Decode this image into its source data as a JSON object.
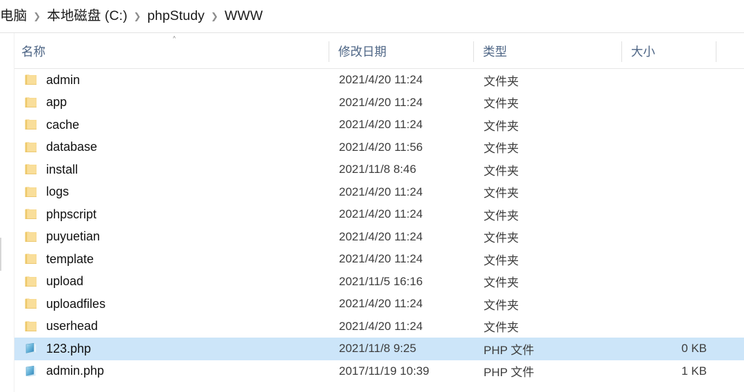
{
  "window": {
    "title": "WWW"
  },
  "breadcrumb": {
    "separator": "❯",
    "items": [
      {
        "label": "电脑"
      },
      {
        "label": "本地磁盘 (C:)"
      },
      {
        "label": "phpStudy"
      },
      {
        "label": "WWW"
      }
    ]
  },
  "columns": {
    "sort_indicator": "˄",
    "sorted_by": "name",
    "sort_direction": "ascending",
    "headers": [
      {
        "key": "name",
        "label": "名称"
      },
      {
        "key": "date",
        "label": "修改日期"
      },
      {
        "key": "type",
        "label": "类型"
      },
      {
        "key": "size",
        "label": "大小"
      }
    ]
  },
  "colors": {
    "selection": "#cce5f9",
    "folder_icon": "#f5d municipal",
    "header_text": "#4d6585"
  },
  "files": [
    {
      "name": "admin",
      "date": "2021/4/20 11:24",
      "type": "文件夹",
      "size": "",
      "icon": "folder-icon",
      "selected": false
    },
    {
      "name": "app",
      "date": "2021/4/20 11:24",
      "type": "文件夹",
      "size": "",
      "icon": "folder-icon",
      "selected": false
    },
    {
      "name": "cache",
      "date": "2021/4/20 11:24",
      "type": "文件夹",
      "size": "",
      "icon": "folder-icon",
      "selected": false
    },
    {
      "name": "database",
      "date": "2021/4/20 11:56",
      "type": "文件夹",
      "size": "",
      "icon": "folder-icon",
      "selected": false
    },
    {
      "name": "install",
      "date": "2021/11/8 8:46",
      "type": "文件夹",
      "size": "",
      "icon": "folder-icon",
      "selected": false
    },
    {
      "name": "logs",
      "date": "2021/4/20 11:24",
      "type": "文件夹",
      "size": "",
      "icon": "folder-icon",
      "selected": false
    },
    {
      "name": "phpscript",
      "date": "2021/4/20 11:24",
      "type": "文件夹",
      "size": "",
      "icon": "folder-icon",
      "selected": false
    },
    {
      "name": "puyuetian",
      "date": "2021/4/20 11:24",
      "type": "文件夹",
      "size": "",
      "icon": "folder-icon",
      "selected": false
    },
    {
      "name": "template",
      "date": "2021/4/20 11:24",
      "type": "文件夹",
      "size": "",
      "icon": "folder-icon",
      "selected": false
    },
    {
      "name": "upload",
      "date": "2021/11/5 16:16",
      "type": "文件夹",
      "size": "",
      "icon": "folder-icon",
      "selected": false
    },
    {
      "name": "uploadfiles",
      "date": "2021/4/20 11:24",
      "type": "文件夹",
      "size": "",
      "icon": "folder-icon",
      "selected": false
    },
    {
      "name": "userhead",
      "date": "2021/4/20 11:24",
      "type": "文件夹",
      "size": "",
      "icon": "folder-icon",
      "selected": false
    },
    {
      "name": "123.php",
      "date": "2021/11/8 9:25",
      "type": "PHP 文件",
      "size": "0 KB",
      "icon": "php-file-icon",
      "selected": true
    },
    {
      "name": "admin.php",
      "date": "2017/11/19 10:39",
      "type": "PHP 文件",
      "size": "1 KB",
      "icon": "php-file-icon",
      "selected": false
    }
  ]
}
